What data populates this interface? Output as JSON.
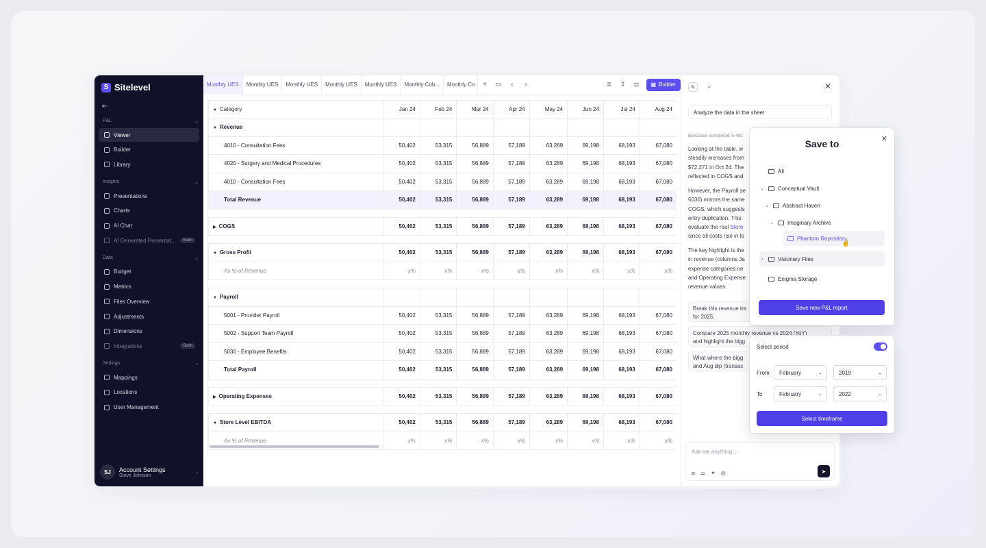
{
  "brand": {
    "logo": "S",
    "name": "Sitelevel"
  },
  "sidebar": {
    "sections": [
      {
        "label": "P&L",
        "items": [
          {
            "label": "Viewer",
            "active": true
          },
          {
            "label": "Builder"
          },
          {
            "label": "Library"
          }
        ]
      },
      {
        "label": "Insights",
        "items": [
          {
            "label": "Presentations"
          },
          {
            "label": "Charts"
          },
          {
            "label": "AI Chat"
          },
          {
            "label": "AI Generated Presentat...",
            "badge": "Soon",
            "disabled": true
          }
        ]
      },
      {
        "label": "Data",
        "items": [
          {
            "label": "Budget"
          },
          {
            "label": "Metrics"
          },
          {
            "label": "Files Overview"
          },
          {
            "label": "Adjustments"
          },
          {
            "label": "Dimensions"
          },
          {
            "label": "Integrations",
            "badge": "Soon",
            "disabled": true
          }
        ]
      },
      {
        "label": "Settings",
        "items": [
          {
            "label": "Mappings"
          },
          {
            "label": "Locations"
          },
          {
            "label": "User Management"
          }
        ]
      }
    ],
    "account": {
      "initials": "SJ",
      "title": "Account Settings",
      "name": "Steve Johnson"
    }
  },
  "tabs": [
    "Monthly UES",
    "Monthly UES",
    "Monthly UES",
    "Monthly UES",
    "Monthly UES",
    "Monthly Cob...",
    "Monthly Co"
  ],
  "toolbar": {
    "builder_label": "Builder"
  },
  "grid": {
    "category_header": "Category",
    "months": [
      "Jan 24",
      "Feb 24",
      "Mar 24",
      "Apr 24",
      "May 24",
      "Jun 24",
      "Jul 24",
      "Aug 24"
    ],
    "rows": [
      {
        "type": "group",
        "label": "Revenue",
        "expanded": true
      },
      {
        "type": "line",
        "label": "4010 - Consultation Fees",
        "values": [
          "50,402",
          "53,315",
          "56,889",
          "57,189",
          "63,289",
          "69,198",
          "68,193",
          "67,080"
        ]
      },
      {
        "type": "line",
        "label": "4020 - Surgery and Medical Procedures",
        "values": [
          "50,402",
          "53,315",
          "56,889",
          "57,189",
          "63,289",
          "69,198",
          "68,193",
          "67,080"
        ]
      },
      {
        "type": "line",
        "label": "4010 - Consultation Fees",
        "values": [
          "50,402",
          "53,315",
          "56,889",
          "57,189",
          "63,289",
          "69,198",
          "68,193",
          "67,080"
        ]
      },
      {
        "type": "total",
        "label": "Total Revenue",
        "values": [
          "50,402",
          "53,315",
          "56,889",
          "57,189",
          "63,289",
          "69,198",
          "68,193",
          "67,080"
        ]
      },
      {
        "type": "gap"
      },
      {
        "type": "bold",
        "label": "COGS",
        "expanded": false,
        "values": [
          "50,402",
          "53,315",
          "56,889",
          "57,189",
          "63,289",
          "69,198",
          "68,193",
          "67,080"
        ]
      },
      {
        "type": "gap"
      },
      {
        "type": "bold",
        "label": "Gross Profit",
        "expanded": true,
        "values": [
          "50,402",
          "53,315",
          "56,889",
          "57,189",
          "63,289",
          "69,198",
          "68,193",
          "67,080"
        ]
      },
      {
        "type": "pct",
        "label": "As % of Revenue",
        "values": [
          "x%",
          "x%",
          "x%",
          "x%",
          "x%",
          "x%",
          "x%",
          "x%"
        ]
      },
      {
        "type": "gap"
      },
      {
        "type": "group",
        "label": "Payroll",
        "expanded": true
      },
      {
        "type": "line",
        "label": "5001 - Provider Payroll",
        "values": [
          "50,402",
          "53,315",
          "56,889",
          "57,189",
          "63,289",
          "69,198",
          "68,193",
          "67,080"
        ]
      },
      {
        "type": "line",
        "label": "5002 - Support Team Payroll",
        "values": [
          "50,402",
          "53,315",
          "56,889",
          "57,189",
          "63,289",
          "69,198",
          "68,193",
          "67,080"
        ]
      },
      {
        "type": "line",
        "label": "5030 - Employee Benefits",
        "values": [
          "50,402",
          "53,315",
          "56,889",
          "57,189",
          "63,289",
          "69,198",
          "68,193",
          "67,080"
        ]
      },
      {
        "type": "boldplain",
        "label": "Total Payroll",
        "values": [
          "50,402",
          "53,315",
          "56,889",
          "57,189",
          "63,289",
          "69,198",
          "68,193",
          "67,080"
        ]
      },
      {
        "type": "gap"
      },
      {
        "type": "bold",
        "label": "Operating Expenses",
        "expanded": false,
        "values": [
          "50,402",
          "53,315",
          "56,889",
          "57,189",
          "63,289",
          "69,198",
          "68,193",
          "67,080"
        ]
      },
      {
        "type": "gap"
      },
      {
        "type": "bold",
        "label": "Store Level EBITDA",
        "expanded": true,
        "values": [
          "50,402",
          "53,315",
          "56,889",
          "57,189",
          "63,289",
          "69,198",
          "68,193",
          "67,080"
        ]
      },
      {
        "type": "pct",
        "label": "As % of Revenue",
        "values": [
          "x%",
          "x%",
          "x%",
          "x%",
          "x%",
          "x%",
          "x%",
          "x%"
        ]
      }
    ]
  },
  "chat": {
    "query": "Analyze the data in the sheet",
    "exec": "Execution completed in 48s",
    "p1": [
      "Looking at the table, w",
      "steadily increases from",
      "$72,271 in Oct 24. The",
      "reflected in COGS and"
    ],
    "p2": [
      "However, the Payroll se",
      "5030) mirrors the same",
      "COGS, which suggests",
      "entry duplication. This",
      "evaluate the real",
      "since all costs rise in lo"
    ],
    "p2_link": "Store",
    "p3": [
      "The key highlight is the",
      "in revenue (columns Ja",
      "expense categories ne",
      "and Operating Expense",
      "revenue values."
    ],
    "suggestions": [
      "Break this revenue tre\nfor 2025.",
      "Compare 2025 monthly revenue vs 2024 (YoY)\nand highlight the bigg",
      "What where the bigg\nand Aug dip (transac"
    ],
    "ask_placeholder": "Ask me anything..."
  },
  "save_to": {
    "title": "Save to",
    "folders": [
      {
        "label": "All",
        "level": 0,
        "chev": "",
        "icon": "table"
      },
      {
        "label": "Conceptual Vault",
        "level": 0,
        "chev": "⌄"
      },
      {
        "label": "Abstract Haven",
        "level": 1,
        "chev": "⌄"
      },
      {
        "label": "Imaginary Archive",
        "level": 2,
        "chev": "⌄"
      },
      {
        "label": "Phantom Repository",
        "level": 3,
        "chev": "",
        "selected": true
      },
      {
        "label": "Visionary Files",
        "level": 0,
        "chev": "›",
        "hover": true
      },
      {
        "label": "Enigma Storage",
        "level": 0,
        "chev": ""
      }
    ],
    "button": "Save new P&L report"
  },
  "period": {
    "label": "Select period",
    "enabled": true,
    "from_label": "From",
    "to_label": "To",
    "from_month": "February",
    "from_year": "2019",
    "to_month": "February",
    "to_year": "2022",
    "button": "Select timeframe"
  },
  "colors": {
    "accent": "#5b4ff0",
    "sidebar_bg": "#12112a"
  }
}
